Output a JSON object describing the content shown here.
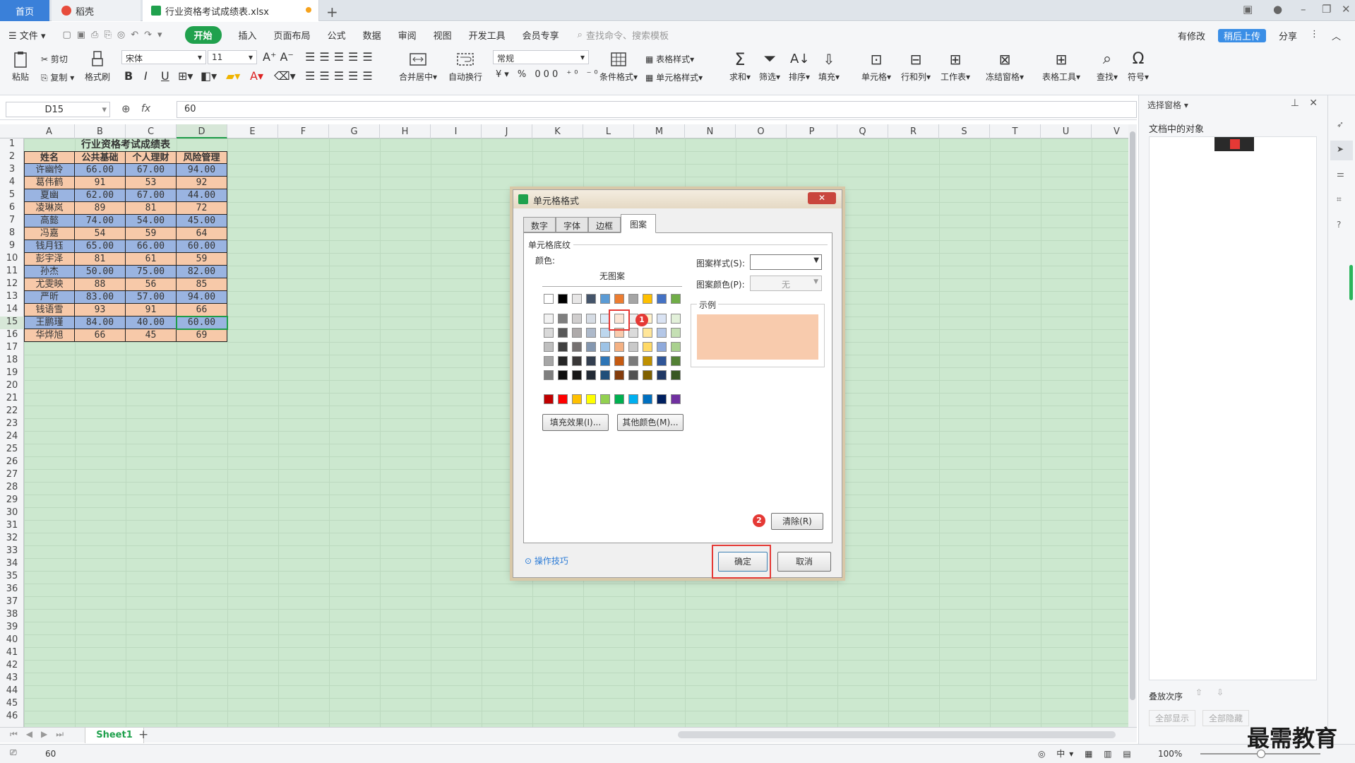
{
  "tabs": {
    "home": "首页",
    "daoke": "稻壳",
    "file": "行业资格考试成绩表.xlsx"
  },
  "menu": {
    "file": "文件",
    "start": "开始",
    "insert": "插入",
    "layout": "页面布局",
    "formula": "公式",
    "data": "数据",
    "review": "审阅",
    "view": "视图",
    "dev": "开发工具",
    "member": "会员专享",
    "search_placeholder": "查找命令、搜索模板",
    "share": "分享",
    "unsynced": "有修改",
    "cloud_badge": "稍后上传"
  },
  "ribbon": {
    "paste": "粘贴",
    "cut": "剪切",
    "copy": "复制",
    "format_painter": "格式刷",
    "font_name": "宋体",
    "font_size": "11",
    "merge": "合并居中",
    "wrap": "自动换行",
    "number_format": "常规",
    "table_style": "表格样式",
    "cond_format": "条件格式",
    "cell_style": "单元格样式",
    "sum": "求和",
    "filter": "筛选",
    "sort": "排序",
    "fill": "填充",
    "cell": "单元格",
    "row_col": "行和列",
    "worksheet": "工作表",
    "freeze": "冻结窗格",
    "table_tools": "表格工具",
    "find": "查找",
    "symbol": "符号"
  },
  "formula_bar": {
    "name_box": "D15",
    "fx": "fx",
    "value": "60"
  },
  "columns": [
    "A",
    "B",
    "C",
    "D",
    "E",
    "F",
    "G",
    "H",
    "I",
    "J",
    "K",
    "L",
    "M",
    "N",
    "O",
    "P",
    "Q",
    "R",
    "S",
    "T",
    "U",
    "V"
  ],
  "rows": [
    "1",
    "2",
    "3",
    "4",
    "5",
    "6",
    "7",
    "8",
    "9",
    "10",
    "11",
    "12",
    "13",
    "14",
    "15",
    "16",
    "17",
    "18",
    "19",
    "20",
    "21",
    "22",
    "23",
    "24",
    "25",
    "26",
    "27",
    "28",
    "29",
    "30",
    "31",
    "32",
    "33",
    "34",
    "35",
    "36",
    "37",
    "38",
    "39",
    "40",
    "41",
    "42",
    "43",
    "44",
    "45",
    "46"
  ],
  "table": {
    "title": "行业资格考试成绩表",
    "headers": [
      "姓名",
      "公共基础",
      "个人理财",
      "风险管理"
    ],
    "rows": [
      [
        "许幽怜",
        "66.00",
        "67.00",
        "94.00"
      ],
      [
        "葛伟鹤",
        "91",
        "53",
        "92"
      ],
      [
        "夏幽",
        "62.00",
        "67.00",
        "44.00"
      ],
      [
        "凌琳岚",
        "89",
        "81",
        "72"
      ],
      [
        "高懿",
        "74.00",
        "54.00",
        "45.00"
      ],
      [
        "冯嘉",
        "54",
        "59",
        "64"
      ],
      [
        "钱月钰",
        "65.00",
        "66.00",
        "60.00"
      ],
      [
        "彭宇泽",
        "81",
        "61",
        "59"
      ],
      [
        "孙杰",
        "50.00",
        "75.00",
        "82.00"
      ],
      [
        "尤雯映",
        "88",
        "56",
        "85"
      ],
      [
        "严昕",
        "83.00",
        "57.00",
        "94.00"
      ],
      [
        "钱语雪",
        "93",
        "91",
        "66"
      ],
      [
        "王鹏瑾",
        "84.00",
        "40.00",
        "60.00"
      ],
      [
        "华烨旭",
        "66",
        "45",
        "69"
      ]
    ]
  },
  "sheet_tab": "Sheet1",
  "status": {
    "value": "60",
    "zoom": "100%"
  },
  "right_panel": {
    "title": "选择窗格",
    "objects": "文档中的对象",
    "order": "叠放次序",
    "show_all": "全部显示",
    "hide_all": "全部隐藏"
  },
  "dialog": {
    "title": "单元格格式",
    "tabs": [
      "数字",
      "字体",
      "边框",
      "图案"
    ],
    "section": "单元格底纹",
    "color_label": "颜色:",
    "no_pattern": "无图案",
    "pattern_style": "图案样式(S):",
    "pattern_color": "图案颜色(P):",
    "pattern_color_value": "无",
    "sample": "示例",
    "fill_effects": "填充效果(I)...",
    "more_colors": "其他颜色(M)...",
    "clear": "清除(R)",
    "tips": "操作技巧",
    "ok": "确定",
    "cancel": "取消",
    "sample_color": "#f8cbad",
    "badge1": "1",
    "badge2": "2"
  },
  "watermark": "最需教育",
  "colors": {
    "accent": "#20a14d",
    "blue_fill": "#9ab4e1",
    "orange_fill": "#f7c9a9",
    "sheet_bg": "#cce8cf",
    "highlight": "#e53935"
  }
}
